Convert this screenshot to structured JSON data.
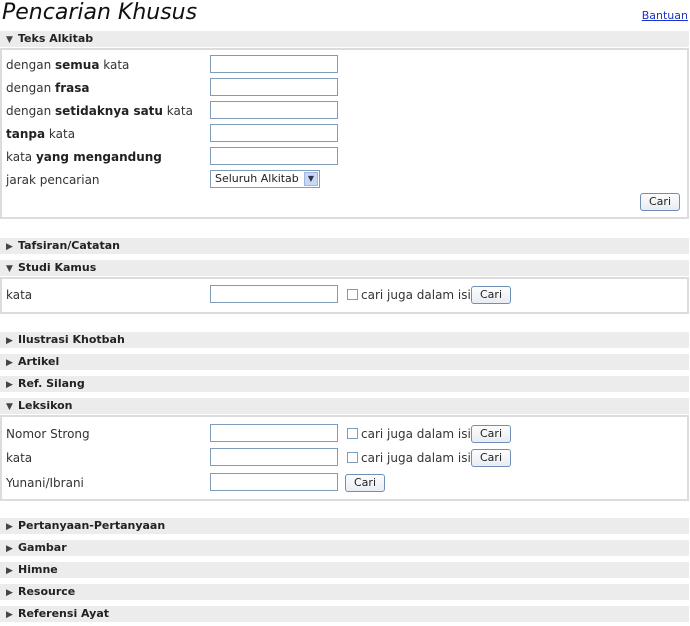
{
  "header": {
    "title": "Pencarian Khusus",
    "help_link": "Bantuan"
  },
  "sections": {
    "teks": "Teks Alkitab",
    "tafsiran": "Tafsiran/Catatan",
    "studi": "Studi Kamus",
    "ilustrasi": "Ilustrasi Khotbah",
    "artikel": "Artikel",
    "refsilang": "Ref. Silang",
    "leksikon": "Leksikon",
    "pertanyaan": "Pertanyaan-Pertanyaan",
    "gambar": "Gambar",
    "himne": "Himne",
    "resource": "Resource",
    "referensi": "Referensi Ayat"
  },
  "teks_form": {
    "r1_pre": "dengan ",
    "r1_b": "semua",
    "r1_post": " kata",
    "r2_pre": "dengan ",
    "r2_b": "frasa",
    "r3_pre": "dengan ",
    "r3_b": "setidaknya satu",
    "r3_post": " kata",
    "r4_b": "tanpa",
    "r4_post": " kata",
    "r5_pre": "kata ",
    "r5_b": "yang mengandung",
    "r6": "jarak pencarian",
    "range_value": "Seluruh Alkitab",
    "search_button": "Cari"
  },
  "studi_form": {
    "label": "kata",
    "checkbox_label": "cari juga dalam isi",
    "search_button": "Cari"
  },
  "leksikon_form": {
    "strong_label": "Nomor Strong",
    "kata_label": "kata",
    "yunani_label": "Yunani/Ibrani",
    "checkbox_label": "cari juga dalam isi",
    "search_button": "Cari"
  },
  "icons": {
    "expanded": "triangle-down-icon",
    "collapsed": "triangle-right-icon"
  }
}
